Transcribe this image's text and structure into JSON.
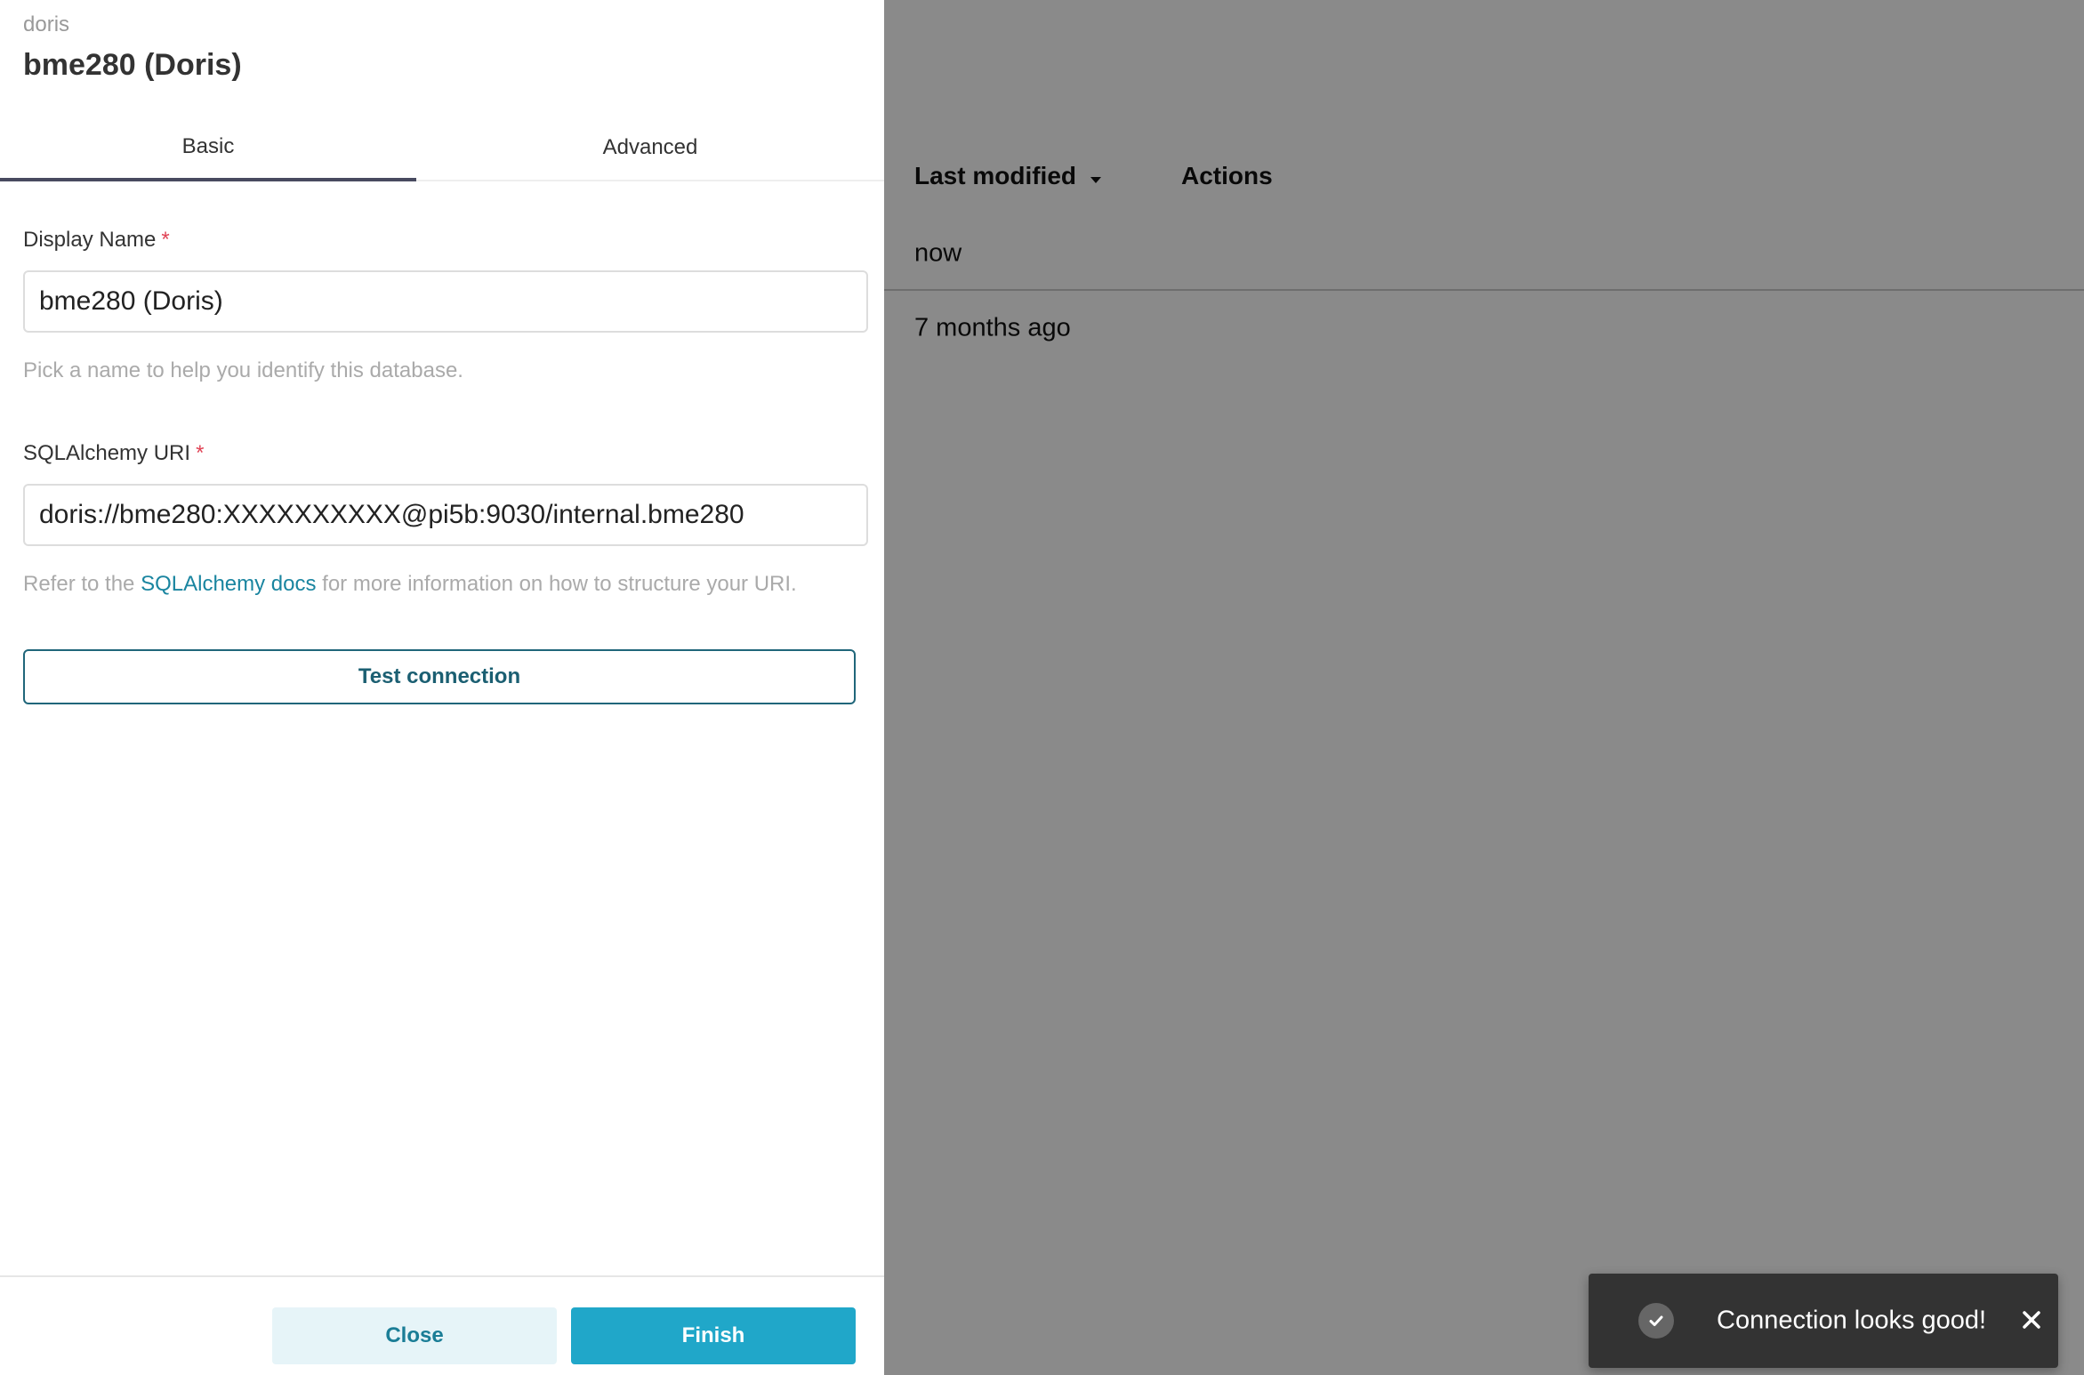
{
  "background_table": {
    "columns": {
      "last_modified": "Last modified",
      "actions": "Actions"
    },
    "rows": [
      "now",
      "7 months ago"
    ]
  },
  "drawer": {
    "subtitle": "doris",
    "title": "bme280 (Doris)",
    "tabs": [
      {
        "label": "Basic",
        "active": true
      },
      {
        "label": "Advanced",
        "active": false
      }
    ],
    "display_name": {
      "label": "Display Name",
      "required_mark": "*",
      "value": "bme280 (Doris)",
      "helper": "Pick a name to help you identify this database."
    },
    "sqlalchemy_uri": {
      "label": "SQLAlchemy URI",
      "required_mark": "*",
      "value": "doris://bme280:XXXXXXXXXX@pi5b:9030/internal.bme280",
      "helper_prefix": "Refer to the ",
      "helper_link": "SQLAlchemy docs",
      "helper_suffix": " for more information on how to structure your URI."
    },
    "test_connection_label": "Test connection",
    "footer": {
      "close_label": "Close",
      "finish_label": "Finish"
    }
  },
  "toast": {
    "message": "Connection looks good!",
    "icon": "check-circle-icon"
  },
  "colors": {
    "accent": "#20a7c9",
    "accent_dark": "#20667a",
    "required": "#e04355",
    "toast_bg": "#333333"
  }
}
